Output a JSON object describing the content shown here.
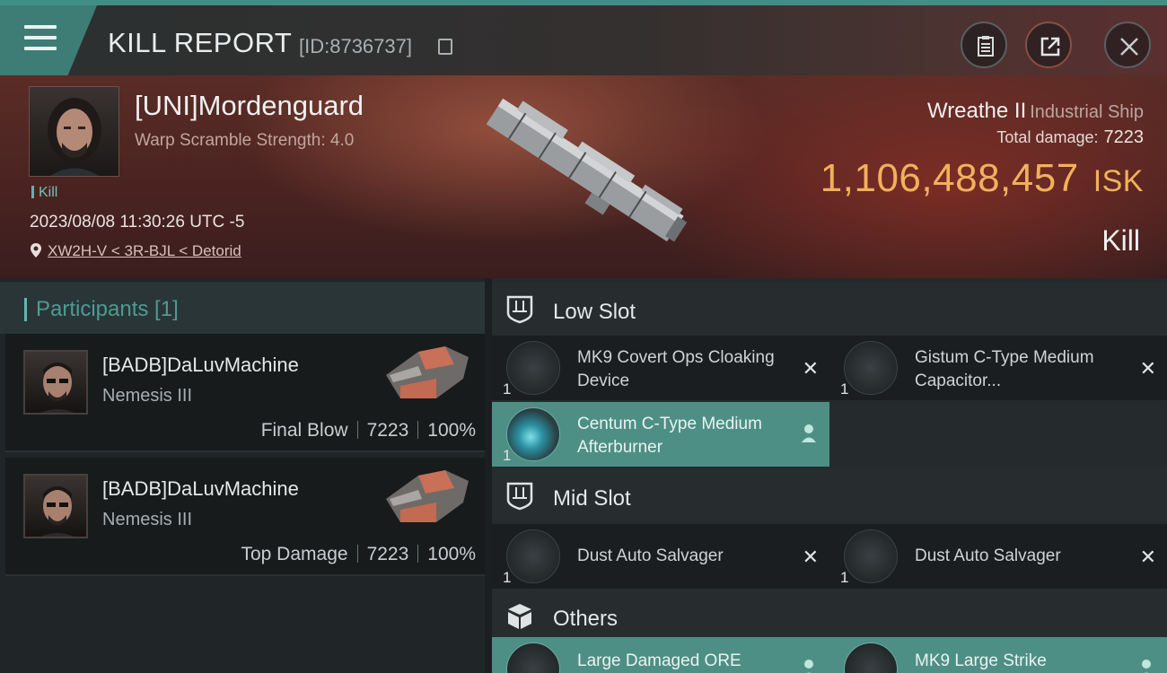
{
  "header": {
    "title": "KILL REPORT",
    "report_id": "[ID:8736737]"
  },
  "victim": {
    "name": "[UNI]Mordenguard",
    "subtitle": "Warp Scramble Strength: 4.0",
    "tag": "Kill",
    "datetime": "2023/08/08 11:30:26 UTC -5",
    "location": "XW2H-V < 3R-BJL < Detorid",
    "ship_name": "Wreathe II",
    "ship_class": "Industrial Ship",
    "total_damage_label": "Total damage:",
    "total_damage": "7223",
    "isk_value": "1,106,488,457",
    "isk_unit": "ISK",
    "result": "Kill"
  },
  "participants": {
    "header": "Participants [1]",
    "rows": [
      {
        "name": "[BADB]DaLuvMachine",
        "ship": "Nemesis III",
        "role": "Final Blow",
        "damage": "7223",
        "percent": "100%"
      },
      {
        "name": "[BADB]DaLuvMachine",
        "ship": "Nemesis III",
        "role": "Top Damage",
        "damage": "7223",
        "percent": "100%"
      }
    ]
  },
  "sections": {
    "low": {
      "title": "Low Slot",
      "modules": [
        {
          "qty": "1",
          "name": "MK9 Covert Ops Cloaking Device"
        },
        {
          "qty": "1",
          "name": "Gistum C-Type Medium Capacitor..."
        },
        {
          "qty": "1",
          "name": "Centum C-Type Medium Afterburner"
        }
      ]
    },
    "mid": {
      "title": "Mid Slot",
      "modules": [
        {
          "qty": "1",
          "name": "Dust Auto Salvager"
        },
        {
          "qty": "1",
          "name": "Dust Auto Salvager"
        }
      ]
    },
    "others": {
      "title": "Others",
      "modules": [
        {
          "qty": "",
          "name": "Large Damaged ORE"
        },
        {
          "qty": "",
          "name": "MK9 Large Strike"
        }
      ]
    }
  },
  "colors": {
    "accent": "#3d7d76",
    "isk": "#f0b15c",
    "active_module": "#4e8f85"
  }
}
